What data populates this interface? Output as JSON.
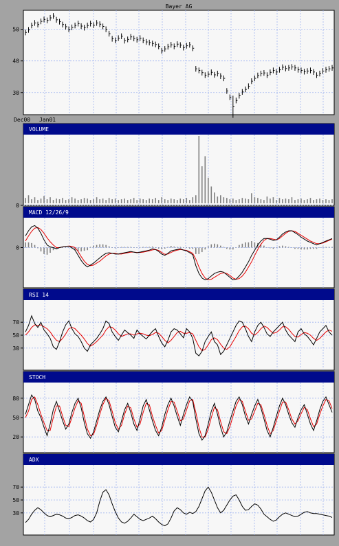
{
  "colors": {
    "frame_bg": "#a3a3a3",
    "plot_bg": "#f7f7f7",
    "header_bar": "#000a8c",
    "grid": "#9fb4f0",
    "black_line": "#000000",
    "red_line": "#e60000",
    "volume_bar": "#808080",
    "header_text": "#ffffff"
  },
  "chart_data": [
    {
      "type": "line",
      "panel": "price",
      "title": "Bayer AG",
      "x_tick_labels": [
        "Dec00",
        "Jan01"
      ],
      "y_ticks": [
        "50",
        "40",
        "30"
      ],
      "ylim": [
        23,
        56
      ],
      "grid": true,
      "style": "ohlc-bars",
      "series": [
        {
          "values": [
            49.0,
            49.8,
            51.2,
            52.0,
            51.5,
            52.5,
            53.1,
            52.8,
            53.6,
            54.2,
            53.0,
            52.4,
            51.5,
            50.8,
            50.0,
            50.6,
            51.2,
            51.8,
            51.0,
            50.5,
            51.2,
            51.8,
            51.3,
            52.0,
            51.6,
            50.9,
            50.0,
            48.6,
            47.0,
            46.5,
            47.2,
            47.8,
            46.4,
            46.8,
            47.6,
            47.1,
            46.7,
            47.2,
            46.5,
            46.0,
            45.8,
            45.5,
            45.2,
            44.6,
            43.2,
            43.8,
            44.5,
            45.1,
            44.6,
            45.3,
            45.0,
            44.2,
            44.8,
            45.1,
            44.0,
            37.5,
            37.0,
            36.3,
            35.5,
            35.8,
            36.4,
            35.6,
            36.0,
            35.2,
            34.5,
            30.5,
            28.5,
            25.5,
            27.5,
            29.0,
            30.2,
            31.0,
            32.0,
            33.6,
            34.5,
            35.4,
            36.0,
            36.2,
            35.5,
            36.4,
            37.0,
            36.5,
            37.2,
            38.0,
            37.6,
            37.8,
            38.1,
            37.8,
            37.2,
            37.0,
            36.6,
            36.8,
            37.0,
            36.5,
            35.5,
            36.0,
            36.8,
            37.2,
            37.5,
            37.8
          ]
        }
      ]
    },
    {
      "type": "bar",
      "panel": "volume",
      "header": "VOLUME",
      "y_ticks": [
        "0"
      ],
      "grid": true,
      "series": [
        {
          "values": [
            8,
            12,
            6,
            9,
            5,
            7,
            11,
            6,
            9,
            5,
            7,
            6,
            8,
            5,
            6,
            9,
            7,
            5,
            6,
            8,
            7,
            5,
            6,
            9,
            6,
            7,
            5,
            8,
            6,
            7,
            5,
            6,
            7,
            5,
            6,
            8,
            5,
            7,
            6,
            5,
            7,
            6,
            8,
            5,
            9,
            6,
            5,
            7,
            6,
            5,
            7,
            6,
            8,
            5,
            9,
            12,
            100,
            55,
            70,
            38,
            25,
            16,
            10,
            12,
            9,
            8,
            6,
            7,
            5,
            6,
            8,
            7,
            6,
            15,
            9,
            8,
            6,
            5,
            10,
            7,
            9,
            5,
            8,
            6,
            7,
            6,
            9,
            5,
            6,
            7,
            5,
            6,
            8,
            5,
            6,
            7,
            5,
            6,
            5,
            6
          ]
        }
      ]
    },
    {
      "type": "bar",
      "panel": "macd",
      "header": "MACD 12/26/9",
      "y_ticks": [
        "0"
      ],
      "grid": true,
      "series": [
        {
          "values": [
            0.9,
            1.3,
            1.6,
            1.7,
            1.5,
            1.1,
            0.6,
            0.2,
            0.05,
            0.0,
            -0.1,
            0.0,
            0.05,
            0.1,
            0.1,
            0.0,
            -0.2,
            -0.6,
            -1.0,
            -1.3,
            -1.5,
            -1.35,
            -1.2,
            -1.0,
            -0.8,
            -0.6,
            -0.45,
            -0.4,
            -0.45,
            -0.5,
            -0.5,
            -0.45,
            -0.4,
            -0.35,
            -0.3,
            -0.35,
            -0.4,
            -0.35,
            -0.3,
            -0.25,
            -0.2,
            -0.1,
            -0.15,
            -0.3,
            -0.5,
            -0.6,
            -0.45,
            -0.25,
            -0.2,
            -0.15,
            -0.1,
            -0.2,
            -0.25,
            -0.4,
            -0.55,
            -1.4,
            -2.0,
            -2.35,
            -2.5,
            -2.4,
            -2.2,
            -2.0,
            -1.9,
            -1.85,
            -1.9,
            -2.1,
            -2.3,
            -2.5,
            -2.45,
            -2.2,
            -1.9,
            -1.5,
            -1.1,
            -0.6,
            -0.2,
            0.2,
            0.5,
            0.7,
            0.7,
            0.65,
            0.55,
            0.6,
            0.8,
            1.05,
            1.2,
            1.3,
            1.3,
            1.15,
            1.0,
            0.8,
            0.65,
            0.5,
            0.4,
            0.3,
            0.2,
            0.3,
            0.4,
            0.5,
            0.6,
            0.7
          ],
          "name": ""
        },
        {
          "values": [
            0.5,
            0.9,
            1.25,
            1.5,
            1.55,
            1.4,
            1.1,
            0.75,
            0.45,
            0.2,
            0.0,
            0.0,
            0.05,
            0.1,
            0.12,
            0.1,
            0.0,
            -0.3,
            -0.7,
            -1.05,
            -1.3,
            -1.4,
            -1.35,
            -1.2,
            -1.05,
            -0.85,
            -0.65,
            -0.5,
            -0.45,
            -0.45,
            -0.5,
            -0.5,
            -0.45,
            -0.4,
            -0.35,
            -0.35,
            -0.38,
            -0.38,
            -0.35,
            -0.3,
            -0.25,
            -0.18,
            -0.15,
            -0.22,
            -0.38,
            -0.52,
            -0.5,
            -0.38,
            -0.28,
            -0.2,
            -0.15,
            -0.18,
            -0.22,
            -0.32,
            -0.45,
            -0.9,
            -1.5,
            -2.0,
            -2.35,
            -2.5,
            -2.45,
            -2.3,
            -2.15,
            -2.0,
            -1.95,
            -2.0,
            -2.15,
            -2.35,
            -2.45,
            -2.4,
            -2.2,
            -1.9,
            -1.5,
            -1.1,
            -0.6,
            -0.15,
            0.25,
            0.55,
            0.7,
            0.7,
            0.65,
            0.6,
            0.7,
            0.9,
            1.1,
            1.25,
            1.3,
            1.25,
            1.1,
            0.95,
            0.8,
            0.65,
            0.5,
            0.4,
            0.3,
            0.3,
            0.35,
            0.45,
            0.55,
            0.65
          ],
          "name": ""
        },
        {
          "values": [
            0.4,
            0.4,
            0.35,
            0.2,
            -0.05,
            -0.3,
            -0.5,
            -0.55,
            -0.4,
            -0.2,
            -0.1,
            0.0,
            0.0,
            0.0,
            -0.02,
            -0.1,
            -0.2,
            -0.3,
            -0.3,
            -0.25,
            -0.2,
            0.05,
            0.15,
            0.2,
            0.25,
            0.25,
            0.2,
            0.1,
            0.0,
            -0.05,
            0.0,
            0.05,
            0.05,
            0.05,
            0.05,
            0.0,
            -0.02,
            0.03,
            0.05,
            0.05,
            0.05,
            0.08,
            0.0,
            -0.08,
            -0.12,
            -0.08,
            0.05,
            0.13,
            0.08,
            0.05,
            0.05,
            -0.02,
            -0.03,
            -0.08,
            -0.1,
            -0.5,
            -0.5,
            -0.35,
            -0.15,
            0.1,
            0.25,
            0.3,
            0.25,
            0.15,
            0.05,
            -0.1,
            -0.15,
            -0.15,
            0.0,
            0.2,
            0.3,
            0.4,
            0.4,
            0.5,
            0.4,
            0.35,
            0.25,
            0.15,
            0.0,
            -0.05,
            -0.1,
            0.0,
            0.1,
            0.15,
            0.1,
            0.05,
            0.0,
            -0.1,
            -0.1,
            -0.15,
            -0.15,
            -0.15,
            -0.1,
            -0.1,
            -0.1,
            0.0,
            0.05,
            0.05,
            0.05,
            0.05
          ],
          "name": ""
        }
      ]
    },
    {
      "type": "line",
      "panel": "rsi",
      "header": "RSI 14",
      "y_ticks": [
        "70",
        "50",
        "30"
      ],
      "ylim": [
        0,
        100
      ],
      "grid": true,
      "series": [
        {
          "values": [
            55,
            65,
            80,
            68,
            62,
            70,
            58,
            52,
            45,
            32,
            28,
            40,
            55,
            66,
            72,
            60,
            52,
            48,
            40,
            30,
            25,
            35,
            40,
            45,
            52,
            60,
            72,
            68,
            55,
            48,
            42,
            50,
            58,
            54,
            50,
            45,
            58,
            52,
            48,
            44,
            50,
            56,
            60,
            48,
            38,
            32,
            42,
            55,
            60,
            58,
            52,
            46,
            60,
            55,
            45,
            22,
            18,
            25,
            40,
            48,
            55,
            40,
            35,
            20,
            25,
            35,
            45,
            55,
            65,
            72,
            70,
            60,
            48,
            40,
            55,
            65,
            70,
            62,
            52,
            48,
            55,
            60,
            65,
            70,
            58,
            50,
            45,
            40,
            55,
            60,
            52,
            48,
            42,
            35,
            45,
            55,
            60,
            65,
            55,
            50
          ]
        },
        {
          "values": [
            50,
            55,
            62,
            66,
            65,
            66,
            63,
            60,
            55,
            48,
            42,
            40,
            45,
            52,
            60,
            62,
            60,
            55,
            50,
            44,
            37,
            33,
            36,
            40,
            45,
            50,
            58,
            63,
            62,
            58,
            52,
            48,
            50,
            52,
            52,
            50,
            52,
            53,
            52,
            50,
            49,
            51,
            54,
            53,
            48,
            42,
            38,
            42,
            48,
            54,
            56,
            53,
            53,
            54,
            52,
            42,
            32,
            26,
            28,
            35,
            43,
            46,
            43,
            36,
            30,
            28,
            32,
            40,
            48,
            57,
            63,
            64,
            60,
            53,
            50,
            54,
            60,
            64,
            62,
            57,
            53,
            54,
            58,
            63,
            63,
            59,
            53,
            48,
            47,
            51,
            54,
            53,
            50,
            45,
            42,
            45,
            50,
            55,
            58,
            56
          ]
        }
      ]
    },
    {
      "type": "line",
      "panel": "stoch",
      "header": "STOCH",
      "y_ticks": [
        "80",
        "50",
        "20"
      ],
      "ylim": [
        0,
        100
      ],
      "grid": true,
      "series": [
        {
          "values": [
            55,
            70,
            85,
            78,
            60,
            50,
            35,
            22,
            40,
            62,
            75,
            60,
            45,
            32,
            40,
            58,
            72,
            80,
            65,
            42,
            25,
            18,
            28,
            45,
            62,
            75,
            82,
            70,
            52,
            35,
            28,
            45,
            62,
            72,
            58,
            40,
            30,
            48,
            68,
            78,
            62,
            45,
            30,
            22,
            35,
            55,
            70,
            80,
            68,
            52,
            38,
            55,
            70,
            82,
            75,
            48,
            25,
            15,
            22,
            40,
            60,
            72,
            55,
            35,
            20,
            28,
            45,
            60,
            75,
            82,
            70,
            52,
            40,
            55,
            68,
            78,
            65,
            48,
            30,
            20,
            35,
            52,
            68,
            80,
            70,
            55,
            42,
            35,
            50,
            62,
            70,
            55,
            40,
            30,
            45,
            62,
            75,
            82,
            70,
            58
          ]
        },
        {
          "values": [
            50,
            60,
            78,
            82,
            70,
            55,
            42,
            30,
            30,
            50,
            68,
            68,
            52,
            38,
            36,
            50,
            65,
            76,
            72,
            52,
            32,
            22,
            24,
            38,
            55,
            70,
            80,
            76,
            60,
            42,
            32,
            38,
            55,
            68,
            65,
            48,
            35,
            40,
            58,
            72,
            70,
            52,
            38,
            26,
            30,
            46,
            62,
            75,
            74,
            60,
            45,
            48,
            62,
            76,
            78,
            58,
            35,
            20,
            20,
            32,
            50,
            66,
            62,
            44,
            28,
            25,
            36,
            52,
            68,
            78,
            75,
            60,
            46,
            48,
            60,
            72,
            70,
            55,
            38,
            25,
            30,
            45,
            60,
            74,
            74,
            62,
            48,
            40,
            45,
            56,
            66,
            62,
            48,
            36,
            40,
            55,
            68,
            78,
            76,
            64
          ]
        }
      ]
    },
    {
      "type": "line",
      "panel": "adx",
      "header": "ADX",
      "y_ticks": [
        "70",
        "50",
        "30"
      ],
      "ylim": [
        0,
        100
      ],
      "grid": true,
      "series": [
        {
          "values": [
            15,
            20,
            28,
            34,
            38,
            35,
            30,
            26,
            24,
            26,
            28,
            27,
            25,
            22,
            21,
            23,
            26,
            27,
            25,
            22,
            18,
            16,
            20,
            30,
            48,
            62,
            66,
            58,
            44,
            32,
            22,
            16,
            14,
            17,
            22,
            28,
            24,
            20,
            18,
            20,
            22,
            25,
            21,
            16,
            12,
            10,
            13,
            22,
            33,
            38,
            35,
            30,
            28,
            31,
            29,
            32,
            40,
            52,
            64,
            70,
            62,
            50,
            38,
            30,
            34,
            42,
            50,
            56,
            58,
            50,
            40,
            34,
            35,
            40,
            44,
            42,
            36,
            28,
            24,
            20,
            17,
            19,
            24,
            28,
            30,
            28,
            26,
            24,
            25,
            28,
            31,
            32,
            30,
            29,
            29,
            28,
            27,
            26,
            25,
            23
          ]
        }
      ]
    }
  ]
}
